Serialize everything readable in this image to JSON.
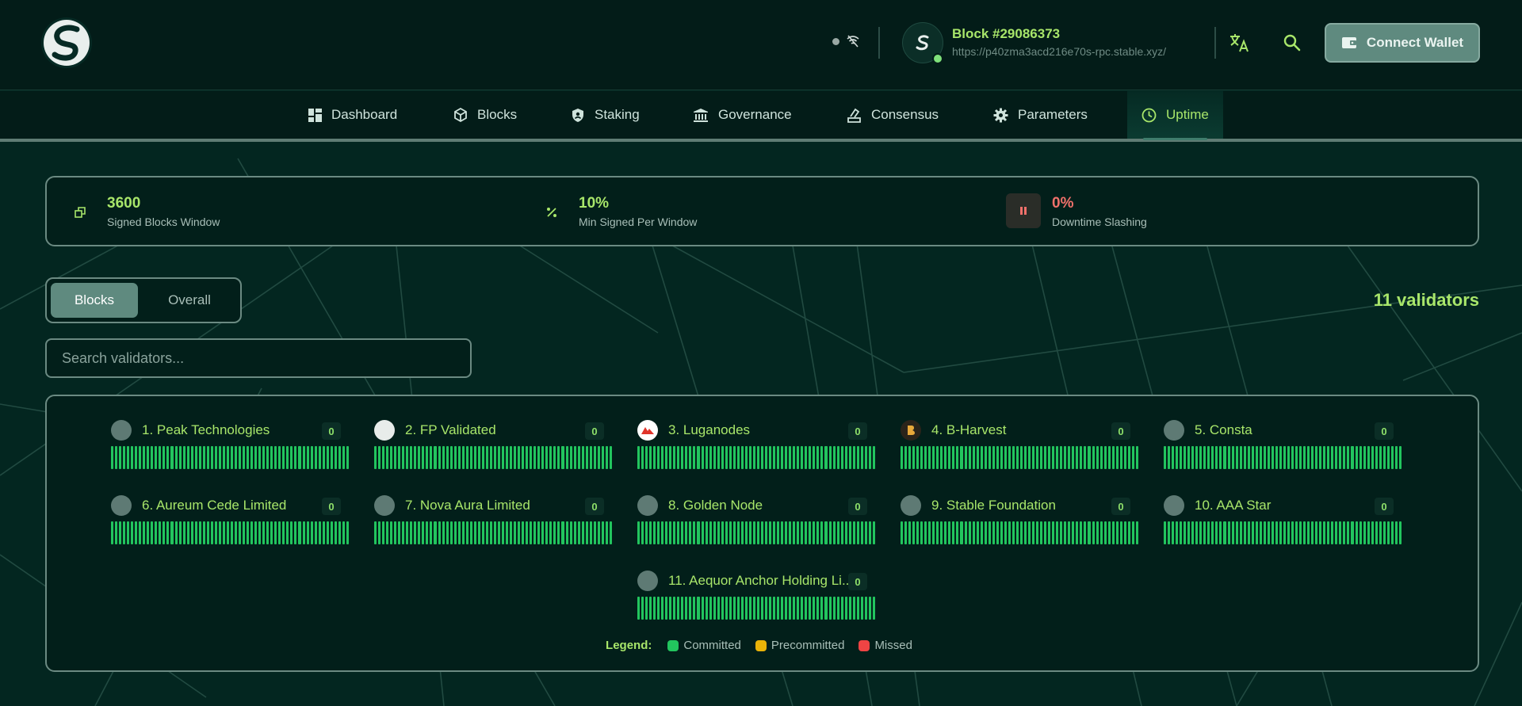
{
  "header": {
    "logo_icon": "stable-logo-icon",
    "block_title": "Block #29086373",
    "rpc_url": "https://p40zma3acd216e70s-rpc.stable.xyz/",
    "connect_label": "Connect Wallet"
  },
  "nav": {
    "items": [
      {
        "label": "Dashboard",
        "icon": "dashboard-icon"
      },
      {
        "label": "Blocks",
        "icon": "cube-icon"
      },
      {
        "label": "Staking",
        "icon": "shield-icon"
      },
      {
        "label": "Governance",
        "icon": "bank-icon"
      },
      {
        "label": "Consensus",
        "icon": "vote-icon"
      },
      {
        "label": "Parameters",
        "icon": "gear-icon"
      },
      {
        "label": "Uptime",
        "icon": "clock-icon"
      }
    ],
    "active": "Uptime"
  },
  "params": [
    {
      "value": "3600",
      "label": "Signed Blocks Window"
    },
    {
      "value": "10%",
      "label": "Min Signed Per Window"
    },
    {
      "value": "0%",
      "label": "Downtime Slashing"
    }
  ],
  "toggle": {
    "blocks": "Blocks",
    "overall": "Overall"
  },
  "validator_count": "11 validators",
  "search": {
    "placeholder": "Search validators..."
  },
  "validators": [
    {
      "name": "1. Peak Technologies",
      "missed": "0"
    },
    {
      "name": "2. FP Validated",
      "missed": "0"
    },
    {
      "name": "3. Luganodes",
      "missed": "0"
    },
    {
      "name": "4. B-Harvest",
      "missed": "0"
    },
    {
      "name": "5. Consta",
      "missed": "0"
    },
    {
      "name": "6. Aureum Cede Limited",
      "missed": "0"
    },
    {
      "name": "7. Nova Aura Limited",
      "missed": "0"
    },
    {
      "name": "8. Golden Node",
      "missed": "0"
    },
    {
      "name": "9. Stable Foundation",
      "missed": "0"
    },
    {
      "name": "10. AAA Star",
      "missed": "0"
    },
    {
      "name": "11. Aequor Anchor Holding Li...",
      "missed": "0"
    }
  ],
  "legend": {
    "title": "Legend:",
    "committed": "Committed",
    "precommitted": "Precommitted",
    "missed": "Missed"
  },
  "colors": {
    "accent": "#a8e66a",
    "committed": "#22c55e",
    "precommitted": "#eab308",
    "missed": "#ef4444",
    "slashing": "#f0716b"
  }
}
